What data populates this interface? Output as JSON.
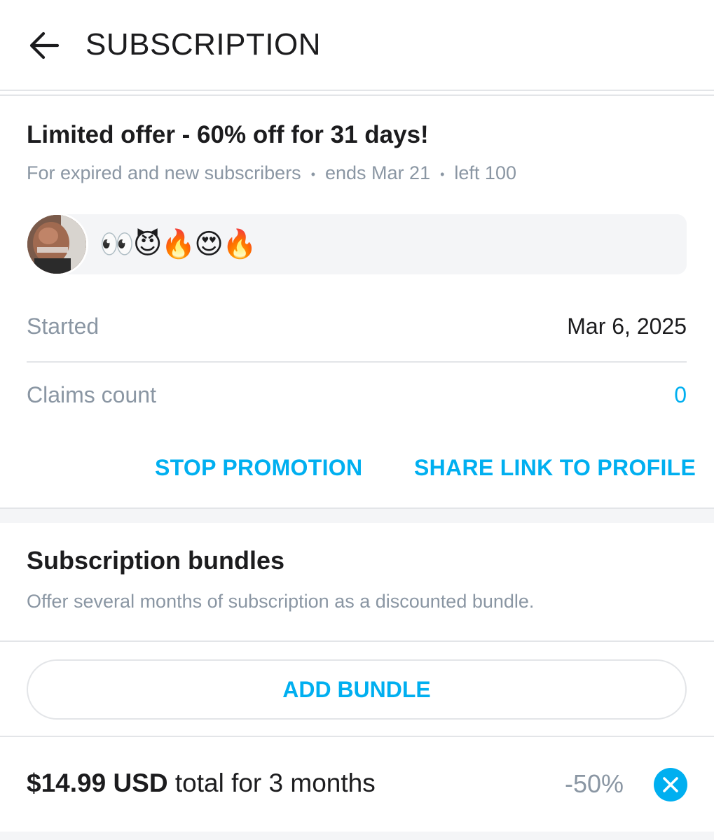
{
  "header": {
    "back_icon": "arrow-left-icon",
    "title": "SUBSCRIPTION"
  },
  "promotion": {
    "title": "Limited offer - 60% off for 31 days!",
    "audience": "For expired and new subscribers",
    "ends": "ends Mar 21",
    "left": "left 100",
    "message": "👀😈🔥😍🔥",
    "started_label": "Started",
    "started_value": "Mar 6, 2025",
    "claims_label": "Claims count",
    "claims_value": "0",
    "stop_label": "STOP PROMOTION",
    "share_label": "SHARE LINK TO PROFILE"
  },
  "bundles": {
    "title": "Subscription bundles",
    "description": "Offer several months of subscription as a discounted bundle.",
    "add_label": "ADD BUNDLE",
    "items": [
      {
        "price": "$14.99 USD",
        "term": "total for 3 months",
        "discount": "-50%",
        "remove_icon": "close-circle-icon"
      }
    ]
  },
  "colors": {
    "accent": "#00aff0",
    "muted_text": "#8a96a3",
    "primary_text": "#1c1c1e",
    "divider": "#e3e5e8",
    "surface": "#f4f5f7"
  }
}
